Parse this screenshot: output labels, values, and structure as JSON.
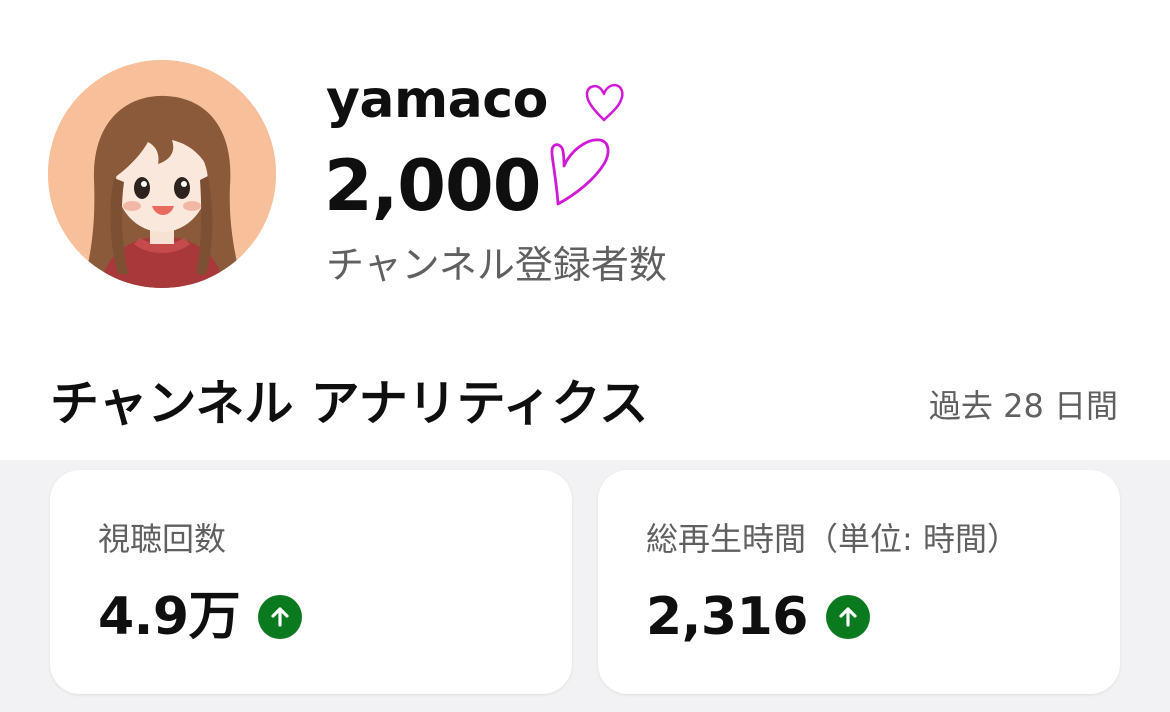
{
  "profile": {
    "channel_name": "yamaco",
    "subscriber_count": "2,000",
    "subscriber_label": "チャンネル登録者数"
  },
  "analytics": {
    "title": "チャンネル アナリティクス",
    "period": "過去 28 日間",
    "cards": [
      {
        "label": "視聴回数",
        "value": "4.9万",
        "trend": "up"
      },
      {
        "label": "総再生時間（単位: 時間）",
        "value": "2,316",
        "trend": "up"
      }
    ]
  },
  "icons": {
    "trend": "arrow-up-circle-icon",
    "doodle": "heart-outline-icon"
  },
  "colors": {
    "trend_up": "#0b7a1e",
    "heart_doodle": "#d01ad6",
    "secondary_text": "#606060",
    "avatar_bg": "#f8c09a"
  }
}
